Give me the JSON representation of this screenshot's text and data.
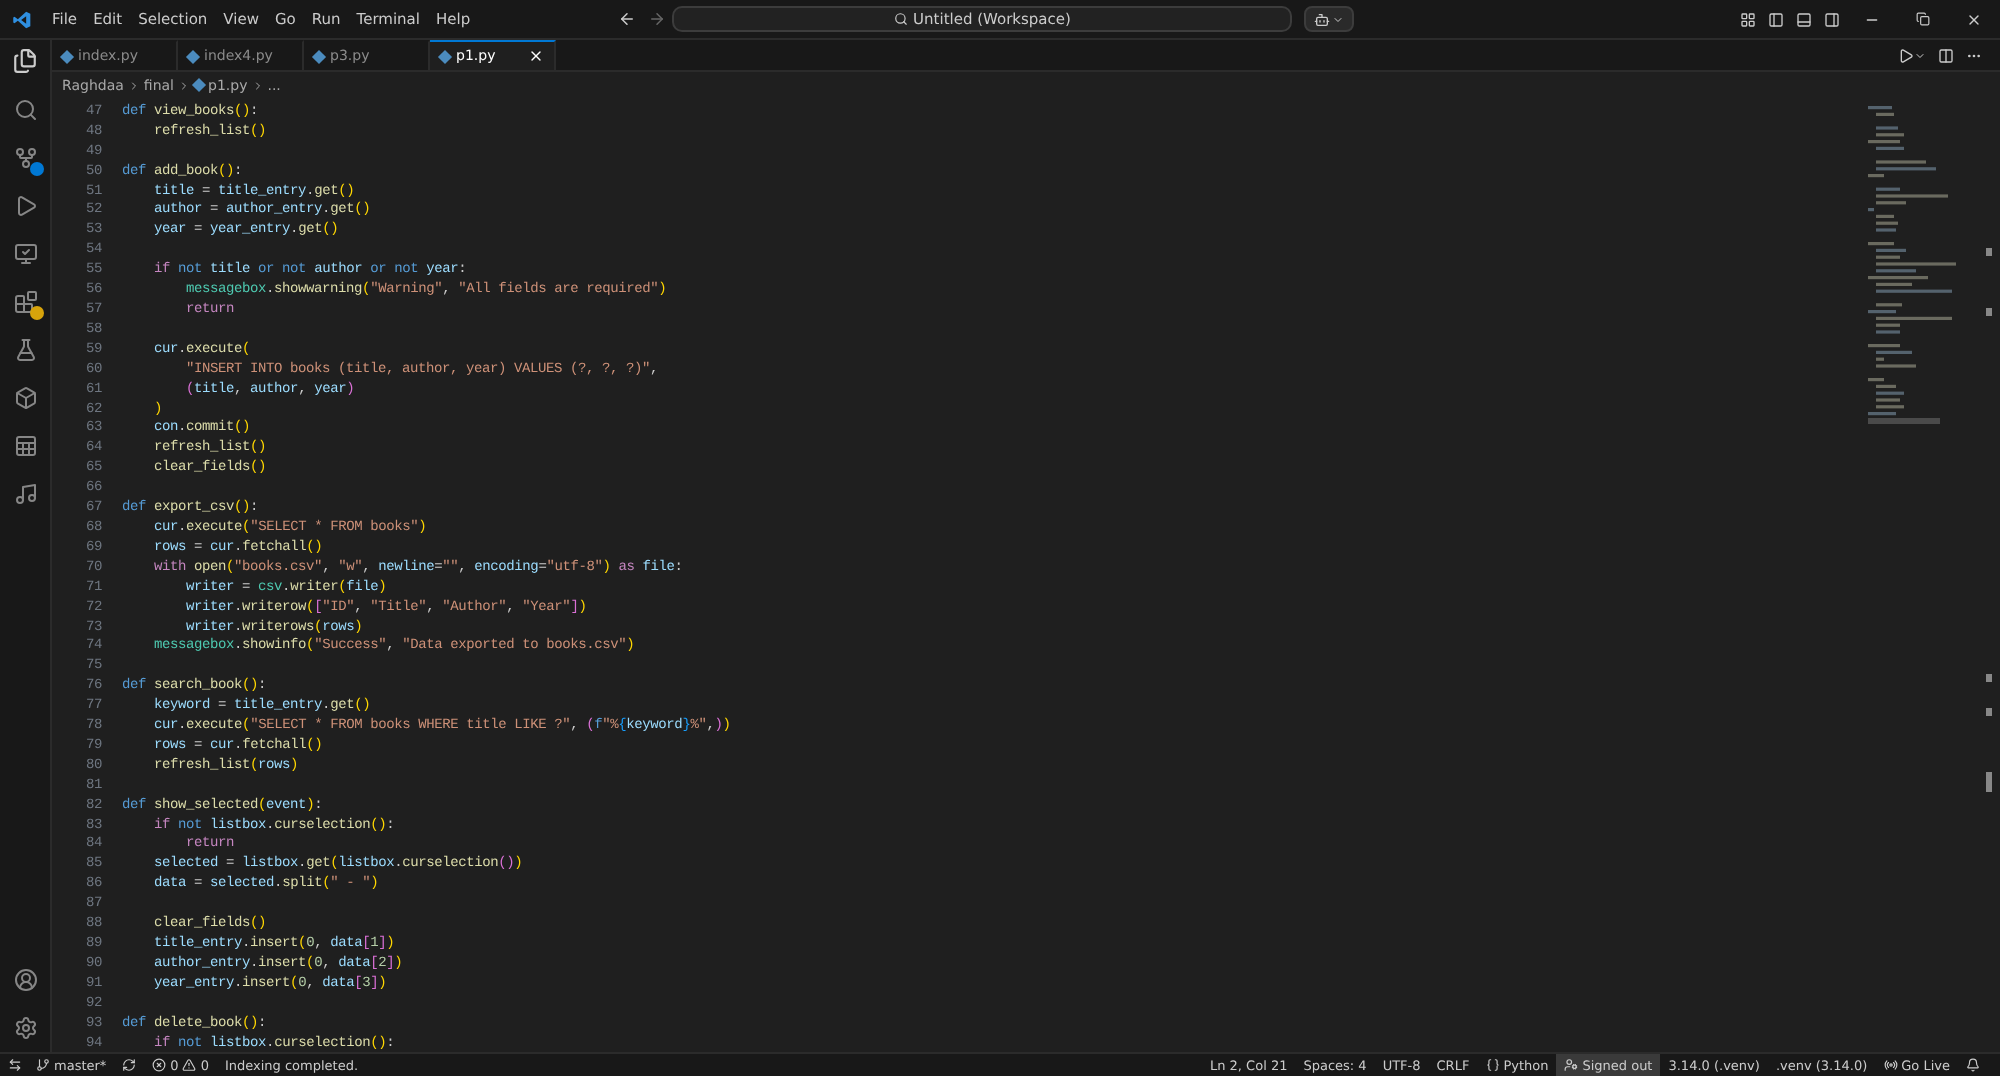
{
  "title_bar": {
    "menu": [
      "File",
      "Edit",
      "Selection",
      "View",
      "Go",
      "Run",
      "Terminal",
      "Help"
    ],
    "command_center": {
      "value": "Untitled (Workspace)"
    }
  },
  "tabs": [
    {
      "label": "index.py",
      "selected": false
    },
    {
      "label": "index4.py",
      "selected": false
    },
    {
      "label": "p3.py",
      "selected": false
    },
    {
      "label": "p1.py",
      "selected": true
    }
  ],
  "breadcrumb": [
    "Raghdaa",
    "final",
    "p1.py",
    "..."
  ],
  "editor": {
    "lines": [
      {
        "number": "47",
        "tokens": [
          {
            "text": "def ",
            "kind": "k"
          },
          {
            "text": "view_books",
            "kind": "f"
          },
          {
            "text": "()",
            "kind": "b1"
          },
          {
            "text": ":",
            "kind": "p"
          }
        ]
      },
      {
        "number": "48",
        "tokens": [
          {
            "text": "    refresh_list",
            "kind": "f"
          },
          {
            "text": "()",
            "kind": "b1"
          }
        ]
      },
      {
        "number": "49"
      },
      {
        "number": "50",
        "tokens": [
          {
            "text": "def ",
            "kind": "k"
          },
          {
            "text": "add_book",
            "kind": "f"
          },
          {
            "text": "()",
            "kind": "b1"
          },
          {
            "text": ":",
            "kind": "p"
          }
        ]
      },
      {
        "number": "51",
        "tokens": [
          {
            "text": "    title",
            "kind": "v"
          },
          {
            "text": " = ",
            "kind": "p"
          },
          {
            "text": "title_entry",
            "kind": "v"
          },
          {
            "text": ".",
            "kind": "p"
          },
          {
            "text": "get",
            "kind": "f"
          },
          {
            "text": "()",
            "kind": "b1"
          }
        ]
      },
      {
        "number": "52",
        "tokens": [
          {
            "text": "    author",
            "kind": "v"
          },
          {
            "text": " = ",
            "kind": "p"
          },
          {
            "text": "author_entry",
            "kind": "v"
          },
          {
            "text": ".",
            "kind": "p"
          },
          {
            "text": "get",
            "kind": "f"
          },
          {
            "text": "()",
            "kind": "b1"
          }
        ]
      },
      {
        "number": "53",
        "tokens": [
          {
            "text": "    year",
            "kind": "v"
          },
          {
            "text": " = ",
            "kind": "p"
          },
          {
            "text": "year_entry",
            "kind": "v"
          },
          {
            "text": ".",
            "kind": "p"
          },
          {
            "text": "get",
            "kind": "f"
          },
          {
            "text": "()",
            "kind": "b1"
          }
        ]
      },
      {
        "number": "54"
      },
      {
        "number": "55",
        "tokens": [
          {
            "text": "    if ",
            "kind": "c"
          },
          {
            "text": "not ",
            "kind": "k"
          },
          {
            "text": "title ",
            "kind": "v"
          },
          {
            "text": "or not ",
            "kind": "k"
          },
          {
            "text": "author ",
            "kind": "v"
          },
          {
            "text": "or not ",
            "kind": "k"
          },
          {
            "text": "year",
            "kind": "v"
          },
          {
            "text": ":",
            "kind": "p"
          }
        ]
      },
      {
        "number": "56",
        "tokens": [
          {
            "text": "        messagebox",
            "kind": "t"
          },
          {
            "text": ".",
            "kind": "p"
          },
          {
            "text": "showwarning",
            "kind": "f"
          },
          {
            "text": "(",
            "kind": "b1"
          },
          {
            "text": "\"Warning\"",
            "kind": "s"
          },
          {
            "text": ", ",
            "kind": "p"
          },
          {
            "text": "\"All fields are required\"",
            "kind": "s"
          },
          {
            "text": ")",
            "kind": "b1"
          }
        ]
      },
      {
        "number": "57",
        "tokens": [
          {
            "text": "        return",
            "kind": "c"
          }
        ]
      },
      {
        "number": "58"
      },
      {
        "number": "59",
        "tokens": [
          {
            "text": "    cur",
            "kind": "v"
          },
          {
            "text": ".",
            "kind": "p"
          },
          {
            "text": "execute",
            "kind": "f"
          },
          {
            "text": "(",
            "kind": "b1"
          }
        ]
      },
      {
        "number": "60",
        "tokens": [
          {
            "text": "        \"INSERT INTO books (title, author, year) VALUES (?, ?, ?)\"",
            "kind": "s"
          },
          {
            "text": ",",
            "kind": "p"
          }
        ]
      },
      {
        "number": "61",
        "tokens": [
          {
            "text": "        (",
            "kind": "b2"
          },
          {
            "text": "title",
            "kind": "v"
          },
          {
            "text": ", ",
            "kind": "p"
          },
          {
            "text": "author",
            "kind": "v"
          },
          {
            "text": ", ",
            "kind": "p"
          },
          {
            "text": "year",
            "kind": "v"
          },
          {
            "text": ")",
            "kind": "b2"
          }
        ]
      },
      {
        "number": "62",
        "tokens": [
          {
            "text": "    )",
            "kind": "b1"
          }
        ]
      },
      {
        "number": "63",
        "tokens": [
          {
            "text": "    con",
            "kind": "v"
          },
          {
            "text": ".",
            "kind": "p"
          },
          {
            "text": "commit",
            "kind": "f"
          },
          {
            "text": "()",
            "kind": "b1"
          }
        ]
      },
      {
        "number": "64",
        "tokens": [
          {
            "text": "    refresh_list",
            "kind": "f"
          },
          {
            "text": "()",
            "kind": "b1"
          }
        ]
      },
      {
        "number": "65",
        "tokens": [
          {
            "text": "    clear_fields",
            "kind": "f"
          },
          {
            "text": "()",
            "kind": "b1"
          }
        ]
      },
      {
        "number": "66"
      },
      {
        "number": "67",
        "tokens": [
          {
            "text": "def ",
            "kind": "k"
          },
          {
            "text": "export_csv",
            "kind": "f"
          },
          {
            "text": "()",
            "kind": "b1"
          },
          {
            "text": ":",
            "kind": "p"
          }
        ]
      },
      {
        "number": "68",
        "tokens": [
          {
            "text": "    cur",
            "kind": "v"
          },
          {
            "text": ".",
            "kind": "p"
          },
          {
            "text": "execute",
            "kind": "f"
          },
          {
            "text": "(",
            "kind": "b1"
          },
          {
            "text": "\"SELECT * FROM books\"",
            "kind": "s"
          },
          {
            "text": ")",
            "kind": "b1"
          }
        ]
      },
      {
        "number": "69",
        "tokens": [
          {
            "text": "    rows",
            "kind": "v"
          },
          {
            "text": " = ",
            "kind": "p"
          },
          {
            "text": "cur",
            "kind": "v"
          },
          {
            "text": ".",
            "kind": "p"
          },
          {
            "text": "fetchall",
            "kind": "f"
          },
          {
            "text": "()",
            "kind": "b1"
          }
        ]
      },
      {
        "number": "70",
        "tokens": [
          {
            "text": "    with ",
            "kind": "c"
          },
          {
            "text": "open",
            "kind": "f"
          },
          {
            "text": "(",
            "kind": "b1"
          },
          {
            "text": "\"books.csv\"",
            "kind": "s"
          },
          {
            "text": ", ",
            "kind": "p"
          },
          {
            "text": "\"w\"",
            "kind": "s"
          },
          {
            "text": ", ",
            "kind": "p"
          },
          {
            "text": "newline",
            "kind": "v"
          },
          {
            "text": "=",
            "kind": "p"
          },
          {
            "text": "\"\"",
            "kind": "s"
          },
          {
            "text": ", ",
            "kind": "p"
          },
          {
            "text": "encoding",
            "kind": "v"
          },
          {
            "text": "=",
            "kind": "p"
          },
          {
            "text": "\"utf-8\"",
            "kind": "s"
          },
          {
            "text": ")",
            "kind": "b1"
          },
          {
            "text": " as ",
            "kind": "c"
          },
          {
            "text": "file",
            "kind": "v"
          },
          {
            "text": ":",
            "kind": "p"
          }
        ]
      },
      {
        "number": "71",
        "tokens": [
          {
            "text": "        writer",
            "kind": "v"
          },
          {
            "text": " = ",
            "kind": "p"
          },
          {
            "text": "csv",
            "kind": "t"
          },
          {
            "text": ".",
            "kind": "p"
          },
          {
            "text": "writer",
            "kind": "f"
          },
          {
            "text": "(",
            "kind": "b1"
          },
          {
            "text": "file",
            "kind": "v"
          },
          {
            "text": ")",
            "kind": "b1"
          }
        ]
      },
      {
        "number": "72",
        "tokens": [
          {
            "text": "        writer",
            "kind": "v"
          },
          {
            "text": ".",
            "kind": "p"
          },
          {
            "text": "writerow",
            "kind": "f"
          },
          {
            "text": "(",
            "kind": "b1"
          },
          {
            "text": "[",
            "kind": "b2"
          },
          {
            "text": "\"ID\"",
            "kind": "s"
          },
          {
            "text": ", ",
            "kind": "p"
          },
          {
            "text": "\"Title\"",
            "kind": "s"
          },
          {
            "text": ", ",
            "kind": "p"
          },
          {
            "text": "\"Author\"",
            "kind": "s"
          },
          {
            "text": ", ",
            "kind": "p"
          },
          {
            "text": "\"Year\"",
            "kind": "s"
          },
          {
            "text": "]",
            "kind": "b2"
          },
          {
            "text": ")",
            "kind": "b1"
          }
        ]
      },
      {
        "number": "73",
        "tokens": [
          {
            "text": "        writer",
            "kind": "v"
          },
          {
            "text": ".",
            "kind": "p"
          },
          {
            "text": "writerows",
            "kind": "f"
          },
          {
            "text": "(",
            "kind": "b1"
          },
          {
            "text": "rows",
            "kind": "v"
          },
          {
            "text": ")",
            "kind": "b1"
          }
        ]
      },
      {
        "number": "74",
        "tokens": [
          {
            "text": "    messagebox",
            "kind": "t"
          },
          {
            "text": ".",
            "kind": "p"
          },
          {
            "text": "showinfo",
            "kind": "f"
          },
          {
            "text": "(",
            "kind": "b1"
          },
          {
            "text": "\"Success\"",
            "kind": "s"
          },
          {
            "text": ", ",
            "kind": "p"
          },
          {
            "text": "\"Data exported to books.csv\"",
            "kind": "s"
          },
          {
            "text": ")",
            "kind": "b1"
          }
        ]
      },
      {
        "number": "75"
      },
      {
        "number": "76",
        "tokens": [
          {
            "text": "def ",
            "kind": "k"
          },
          {
            "text": "search_book",
            "kind": "f"
          },
          {
            "text": "()",
            "kind": "b1"
          },
          {
            "text": ":",
            "kind": "p"
          }
        ]
      },
      {
        "number": "77",
        "tokens": [
          {
            "text": "    keyword",
            "kind": "v"
          },
          {
            "text": " = ",
            "kind": "p"
          },
          {
            "text": "title_entry",
            "kind": "v"
          },
          {
            "text": ".",
            "kind": "p"
          },
          {
            "text": "get",
            "kind": "f"
          },
          {
            "text": "()",
            "kind": "b1"
          }
        ]
      },
      {
        "number": "78",
        "tokens": [
          {
            "text": "    cur",
            "kind": "v"
          },
          {
            "text": ".",
            "kind": "p"
          },
          {
            "text": "execute",
            "kind": "f"
          },
          {
            "text": "(",
            "kind": "b1"
          },
          {
            "text": "\"SELECT * FROM books WHERE title LIKE ?\"",
            "kind": "s"
          },
          {
            "text": ", ",
            "kind": "p"
          },
          {
            "text": "(",
            "kind": "b2"
          },
          {
            "text": "f",
            "kind": "k"
          },
          {
            "text": "\"%",
            "kind": "s"
          },
          {
            "text": "{",
            "kind": "b3"
          },
          {
            "text": "keyword",
            "kind": "v"
          },
          {
            "text": "}",
            "kind": "b3"
          },
          {
            "text": "%\"",
            "kind": "s"
          },
          {
            "text": ",",
            "kind": "p"
          },
          {
            "text": ")",
            "kind": "b2"
          },
          {
            "text": ")",
            "kind": "b1"
          }
        ]
      },
      {
        "number": "79",
        "tokens": [
          {
            "text": "    rows",
            "kind": "v"
          },
          {
            "text": " = ",
            "kind": "p"
          },
          {
            "text": "cur",
            "kind": "v"
          },
          {
            "text": ".",
            "kind": "p"
          },
          {
            "text": "fetchall",
            "kind": "f"
          },
          {
            "text": "()",
            "kind": "b1"
          }
        ]
      },
      {
        "number": "80",
        "tokens": [
          {
            "text": "    refresh_list",
            "kind": "f"
          },
          {
            "text": "(",
            "kind": "b1"
          },
          {
            "text": "rows",
            "kind": "v"
          },
          {
            "text": ")",
            "kind": "b1"
          }
        ]
      },
      {
        "number": "81"
      },
      {
        "number": "82",
        "tokens": [
          {
            "text": "def ",
            "kind": "k"
          },
          {
            "text": "show_selected",
            "kind": "f"
          },
          {
            "text": "(",
            "kind": "b1"
          },
          {
            "text": "event",
            "kind": "v"
          },
          {
            "text": ")",
            "kind": "b1"
          },
          {
            "text": ":",
            "kind": "p"
          }
        ]
      },
      {
        "number": "83",
        "tokens": [
          {
            "text": "    if ",
            "kind": "c"
          },
          {
            "text": "not ",
            "kind": "k"
          },
          {
            "text": "listbox",
            "kind": "v"
          },
          {
            "text": ".",
            "kind": "p"
          },
          {
            "text": "curselection",
            "kind": "f"
          },
          {
            "text": "()",
            "kind": "b1"
          },
          {
            "text": ":",
            "kind": "p"
          }
        ]
      },
      {
        "number": "84",
        "tokens": [
          {
            "text": "        return",
            "kind": "c"
          }
        ]
      },
      {
        "number": "85",
        "tokens": [
          {
            "text": "    selected",
            "kind": "v"
          },
          {
            "text": " = ",
            "kind": "p"
          },
          {
            "text": "listbox",
            "kind": "v"
          },
          {
            "text": ".",
            "kind": "p"
          },
          {
            "text": "get",
            "kind": "f"
          },
          {
            "text": "(",
            "kind": "b1"
          },
          {
            "text": "listbox",
            "kind": "v"
          },
          {
            "text": ".",
            "kind": "p"
          },
          {
            "text": "curselection",
            "kind": "f"
          },
          {
            "text": "()",
            "kind": "b2"
          },
          {
            "text": ")",
            "kind": "b1"
          }
        ]
      },
      {
        "number": "86",
        "tokens": [
          {
            "text": "    data",
            "kind": "v"
          },
          {
            "text": " = ",
            "kind": "p"
          },
          {
            "text": "selected",
            "kind": "v"
          },
          {
            "text": ".",
            "kind": "p"
          },
          {
            "text": "split",
            "kind": "f"
          },
          {
            "text": "(",
            "kind": "b1"
          },
          {
            "text": "\" - \"",
            "kind": "s"
          },
          {
            "text": ")",
            "kind": "b1"
          }
        ]
      },
      {
        "number": "87"
      },
      {
        "number": "88",
        "tokens": [
          {
            "text": "    clear_fields",
            "kind": "f"
          },
          {
            "text": "()",
            "kind": "b1"
          }
        ]
      },
      {
        "number": "89",
        "tokens": [
          {
            "text": "    title_entry",
            "kind": "v"
          },
          {
            "text": ".",
            "kind": "p"
          },
          {
            "text": "insert",
            "kind": "f"
          },
          {
            "text": "(",
            "kind": "b1"
          },
          {
            "text": "0",
            "kind": "n"
          },
          {
            "text": ", ",
            "kind": "p"
          },
          {
            "text": "data",
            "kind": "v"
          },
          {
            "text": "[",
            "kind": "b2"
          },
          {
            "text": "1",
            "kind": "n"
          },
          {
            "text": "]",
            "kind": "b2"
          },
          {
            "text": ")",
            "kind": "b1"
          }
        ]
      },
      {
        "number": "90",
        "tokens": [
          {
            "text": "    author_entry",
            "kind": "v"
          },
          {
            "text": ".",
            "kind": "p"
          },
          {
            "text": "insert",
            "kind": "f"
          },
          {
            "text": "(",
            "kind": "b1"
          },
          {
            "text": "0",
            "kind": "n"
          },
          {
            "text": ", ",
            "kind": "p"
          },
          {
            "text": "data",
            "kind": "v"
          },
          {
            "text": "[",
            "kind": "b2"
          },
          {
            "text": "2",
            "kind": "n"
          },
          {
            "text": "]",
            "kind": "b2"
          },
          {
            "text": ")",
            "kind": "b1"
          }
        ]
      },
      {
        "number": "91",
        "tokens": [
          {
            "text": "    year_entry",
            "kind": "v"
          },
          {
            "text": ".",
            "kind": "p"
          },
          {
            "text": "insert",
            "kind": "f"
          },
          {
            "text": "(",
            "kind": "b1"
          },
          {
            "text": "0",
            "kind": "n"
          },
          {
            "text": ", ",
            "kind": "p"
          },
          {
            "text": "data",
            "kind": "v"
          },
          {
            "text": "[",
            "kind": "b2"
          },
          {
            "text": "3",
            "kind": "n"
          },
          {
            "text": "]",
            "kind": "b2"
          },
          {
            "text": ")",
            "kind": "b1"
          }
        ]
      },
      {
        "number": "92"
      },
      {
        "number": "93",
        "tokens": [
          {
            "text": "def ",
            "kind": "k"
          },
          {
            "text": "delete_book",
            "kind": "f"
          },
          {
            "text": "()",
            "kind": "b1"
          },
          {
            "text": ":",
            "kind": "p"
          }
        ]
      },
      {
        "number": "94",
        "tokens": [
          {
            "text": "    if ",
            "kind": "c"
          },
          {
            "text": "not ",
            "kind": "k"
          },
          {
            "text": "listbox",
            "kind": "v"
          },
          {
            "text": ".",
            "kind": "p"
          },
          {
            "text": "curselection",
            "kind": "f"
          },
          {
            "text": "()",
            "kind": "b1"
          },
          {
            "text": ":",
            "kind": "p"
          }
        ]
      }
    ]
  },
  "status_bar": {
    "branch": "master*",
    "errors": "0",
    "warnings": "0",
    "message": "Indexing completed.",
    "right": [
      {
        "text": "Ln 2, Col 21",
        "kind": "plain"
      },
      {
        "text": "Spaces: 4",
        "kind": "plain"
      },
      {
        "text": "UTF-8",
        "kind": "plain"
      },
      {
        "text": "CRLF",
        "kind": "plain"
      },
      {
        "text": "Python",
        "kind": "language"
      },
      {
        "text": "Signed out",
        "kind": "account"
      },
      {
        "text": "3.14.0 (.venv)",
        "kind": "plain"
      },
      {
        "text": ".venv (3.14.0)",
        "kind": "plain"
      },
      {
        "text": "Go Live",
        "kind": "live"
      }
    ]
  }
}
